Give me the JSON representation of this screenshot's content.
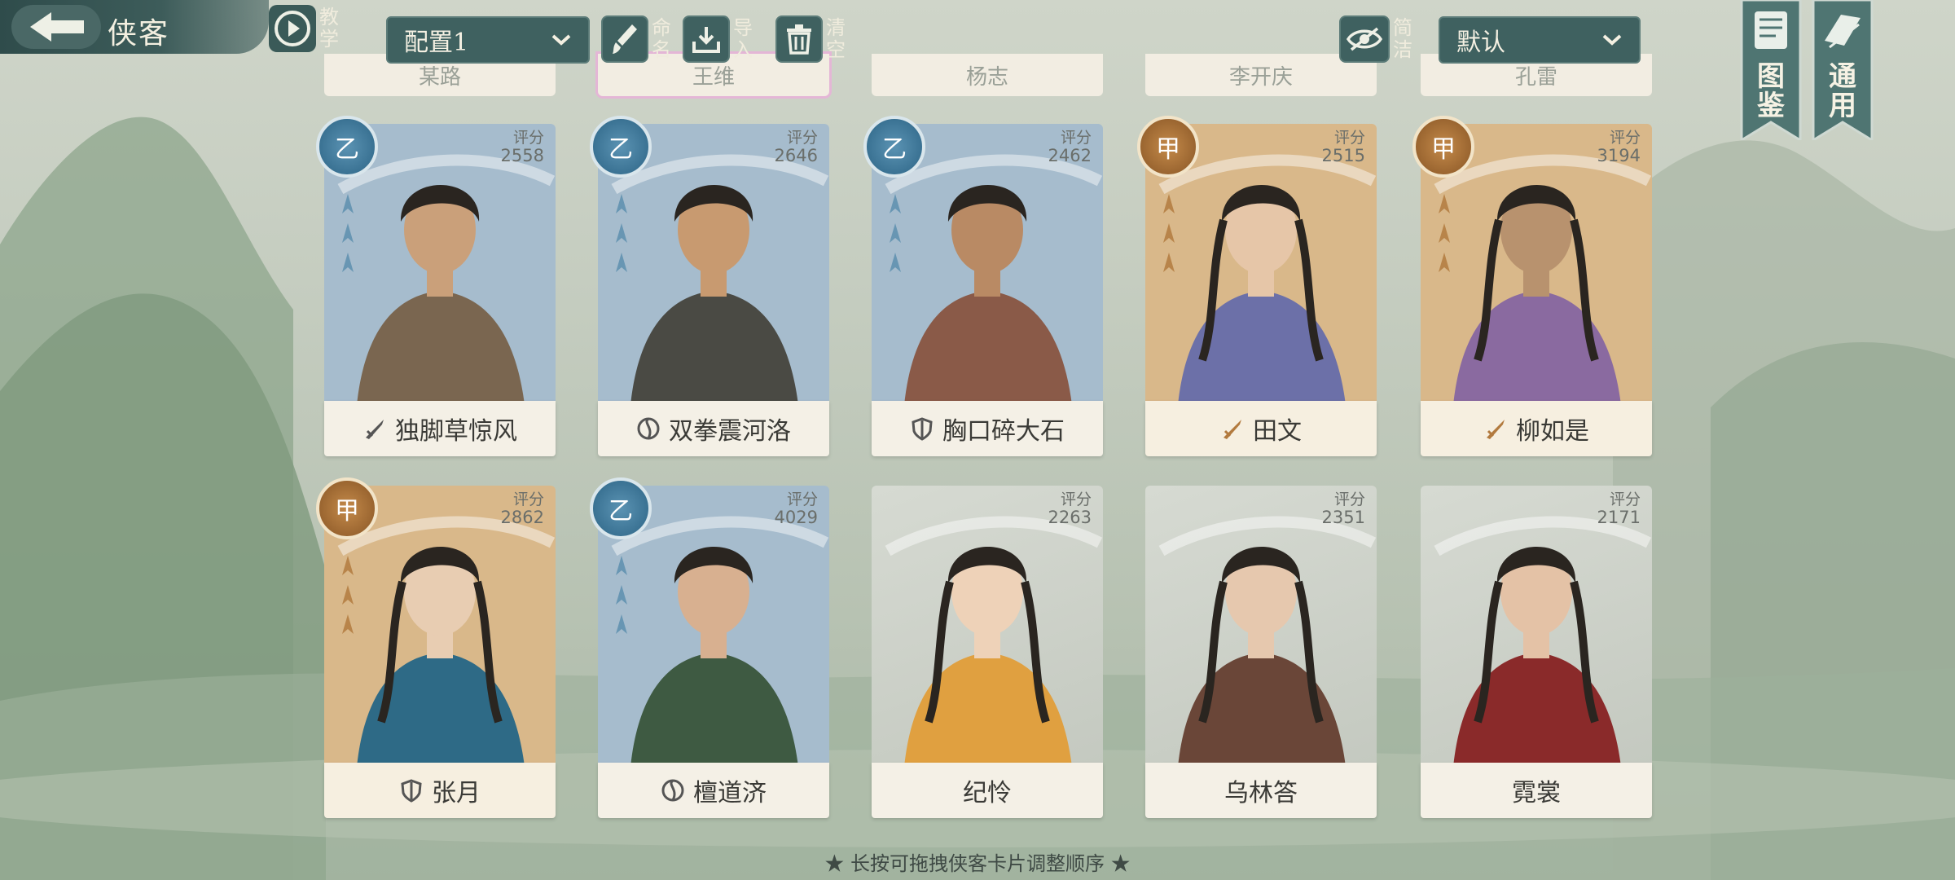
{
  "header": {
    "title": "侠客",
    "tutorial_label": [
      "教",
      "学"
    ],
    "config_select": "配置1",
    "rename_label": [
      "命",
      "名"
    ],
    "import_label": [
      "导",
      "入"
    ],
    "clear_label": [
      "清",
      "空"
    ],
    "simple_label": [
      "简",
      "洁"
    ],
    "sort_select": "默认",
    "codex_label": [
      "图",
      "鉴"
    ],
    "general_label": [
      "通",
      "用"
    ]
  },
  "partial_row": [
    "某路",
    "王维",
    "杨志",
    "李开庆",
    "孔雷"
  ],
  "cards": [
    {
      "name": "独脚草惊风",
      "score_label": "评分",
      "score": "2558",
      "rank": "乙",
      "tier": "blue",
      "class_icon": "blade-icon"
    },
    {
      "name": "双拳震河洛",
      "score_label": "评分",
      "score": "2646",
      "rank": "乙",
      "tier": "blue",
      "class_icon": "taiji-icon"
    },
    {
      "name": "胸口碎大石",
      "score_label": "评分",
      "score": "2462",
      "rank": "乙",
      "tier": "blue",
      "class_icon": "shield-icon"
    },
    {
      "name": "田文",
      "score_label": "评分",
      "score": "2515",
      "rank": "甲",
      "tier": "gold",
      "class_icon": "blade-icon"
    },
    {
      "name": "柳如是",
      "score_label": "评分",
      "score": "3194",
      "rank": "甲",
      "tier": "gold",
      "class_icon": "blade-icon"
    },
    {
      "name": "张月",
      "score_label": "评分",
      "score": "2862",
      "rank": "甲",
      "tier": "gold",
      "class_icon": "shield-icon"
    },
    {
      "name": "檀道济",
      "score_label": "评分",
      "score": "4029",
      "rank": "乙",
      "tier": "blue",
      "class_icon": "taiji-icon"
    },
    {
      "name": "纪怜",
      "score_label": "评分",
      "score": "2263",
      "rank": "",
      "tier": "plain",
      "class_icon": ""
    },
    {
      "name": "乌林答",
      "score_label": "评分",
      "score": "2351",
      "rank": "",
      "tier": "plain",
      "class_icon": ""
    },
    {
      "name": "霓裳",
      "score_label": "评分",
      "score": "2171",
      "rank": "",
      "tier": "plain",
      "class_icon": ""
    }
  ],
  "footer_hint": "★ 长按可拖拽侠客卡片调整顺序 ★",
  "colors": {
    "panel": "#3f6160",
    "blue_card": "#9fb6c9",
    "gold_card": "#d9b88a",
    "plain_card": "#d9ddd6"
  }
}
